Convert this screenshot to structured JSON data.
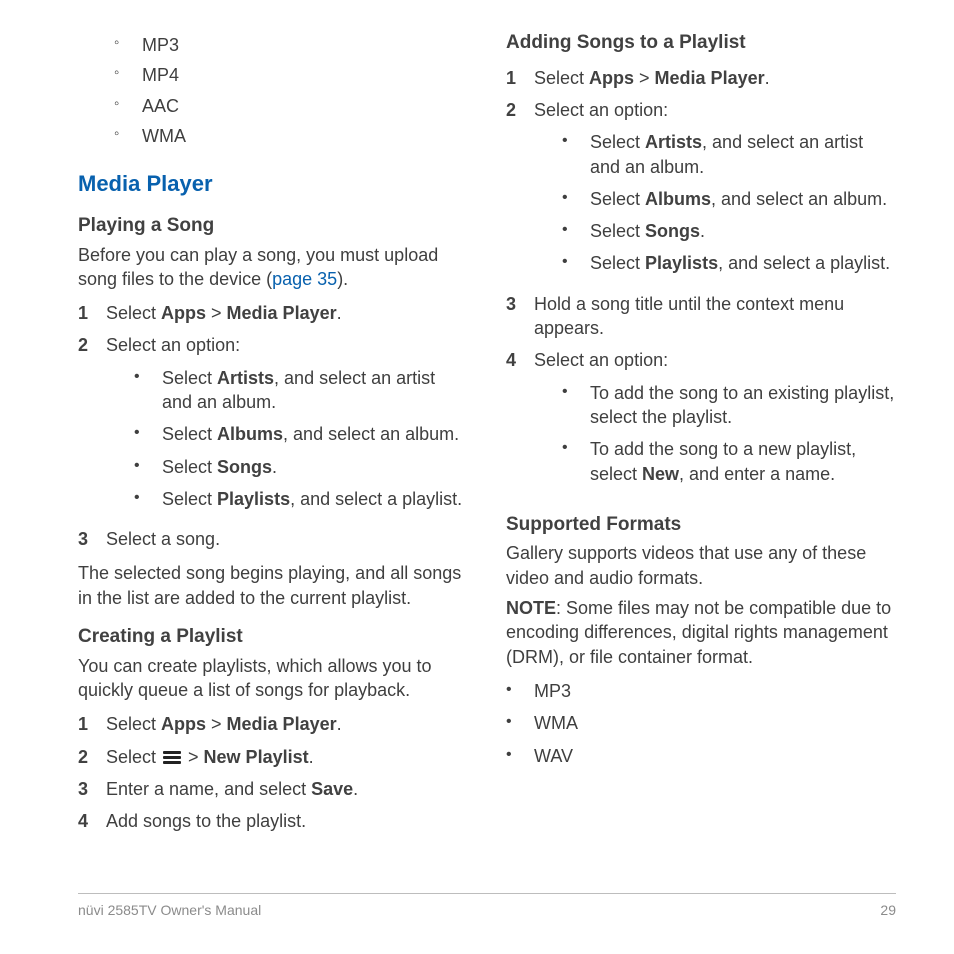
{
  "left": {
    "topFormats": [
      "MP3",
      "MP4",
      "AAC",
      "WMA"
    ],
    "sectionTitle": "Media Player",
    "playing": {
      "heading": "Playing a Song",
      "intro_a": "Before you can play a song, you must upload song files to the device (",
      "intro_link": "page 35",
      "intro_b": ").",
      "step1_a": "Select ",
      "step1_apps": "Apps",
      "step1_gt": " > ",
      "step1_mp": "Media Player",
      "step1_end": ".",
      "step2": "Select an option:",
      "opts": {
        "o1_a": "Select ",
        "o1_b": "Artists",
        "o1_c": ", and select an artist and an album.",
        "o2_a": "Select ",
        "o2_b": "Albums",
        "o2_c": ", and select an album.",
        "o3_a": "Select ",
        "o3_b": "Songs",
        "o3_c": ".",
        "o4_a": "Select ",
        "o4_b": "Playlists",
        "o4_c": ", and select a playlist."
      },
      "step3": "Select a song.",
      "outro": "The selected song begins playing, and all songs in the list are added to the current playlist."
    },
    "creating": {
      "heading": "Creating a Playlist",
      "intro": "You can create playlists, which allows you to quickly queue a list of songs for playback.",
      "s1_a": "Select ",
      "s1_apps": "Apps",
      "s1_gt": " > ",
      "s1_mp": "Media Player",
      "s1_end": ".",
      "s2_a": "Select ",
      "s2_gt": " > ",
      "s2_np": "New Playlist",
      "s2_end": ".",
      "s3_a": "Enter a name, and select ",
      "s3_b": "Save",
      "s3_c": ".",
      "s4": "Add songs to the playlist."
    }
  },
  "right": {
    "adding": {
      "heading": "Adding Songs to a Playlist",
      "s1_a": "Select ",
      "s1_apps": "Apps",
      "s1_gt": " > ",
      "s1_mp": "Media Player",
      "s1_end": ".",
      "s2": "Select an option:",
      "opts": {
        "o1_a": "Select ",
        "o1_b": "Artists",
        "o1_c": ", and select an artist and an album.",
        "o2_a": "Select ",
        "o2_b": "Albums",
        "o2_c": ", and select an album.",
        "o3_a": "Select ",
        "o3_b": "Songs",
        "o3_c": ".",
        "o4_a": "Select ",
        "o4_b": "Playlists",
        "o4_c": ", and select a playlist."
      },
      "s3": "Hold a song title until the context menu appears.",
      "s4": "Select an option:",
      "opts2": {
        "p1": "To add the song to an existing playlist, select the playlist.",
        "p2_a": "To add the song to a new playlist, select ",
        "p2_b": "New",
        "p2_c": ", and enter a name."
      }
    },
    "supported": {
      "heading": "Supported Formats",
      "intro": "Gallery supports videos that use any of these video and audio formats.",
      "note_label": "NOTE",
      "note_body": ": Some files may not be compatible due to encoding differences, digital rights management (DRM), or file container format.",
      "formats": [
        "MP3",
        "WMA",
        "WAV"
      ]
    }
  },
  "footer": {
    "left": "nüvi 2585TV Owner's Manual",
    "right": "29"
  }
}
